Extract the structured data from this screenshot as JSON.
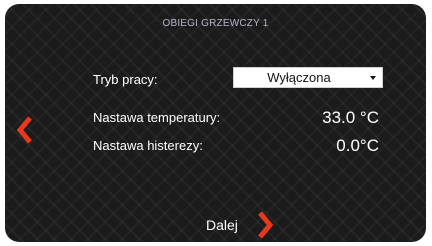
{
  "screen": {
    "title": "OBIEGI GRZEWCZY 1"
  },
  "fields": {
    "mode_label": "Tryb pracy:",
    "mode_value": "Wyłączona",
    "temp_label": "Nastawa temperatury:",
    "temp_value": "33.0 °C",
    "hyst_label": "Nastawa histerezy:",
    "hyst_value": "0.0°C"
  },
  "nav": {
    "next_label": "Dalej"
  },
  "colors": {
    "accent": "#e8391d",
    "background": "#1b1b1b",
    "title": "#b4b4c8",
    "text": "#ffffff"
  },
  "icons": {
    "prev": "chevron-left-icon",
    "next": "chevron-right-icon",
    "dropdown": "caret-down-icon"
  }
}
